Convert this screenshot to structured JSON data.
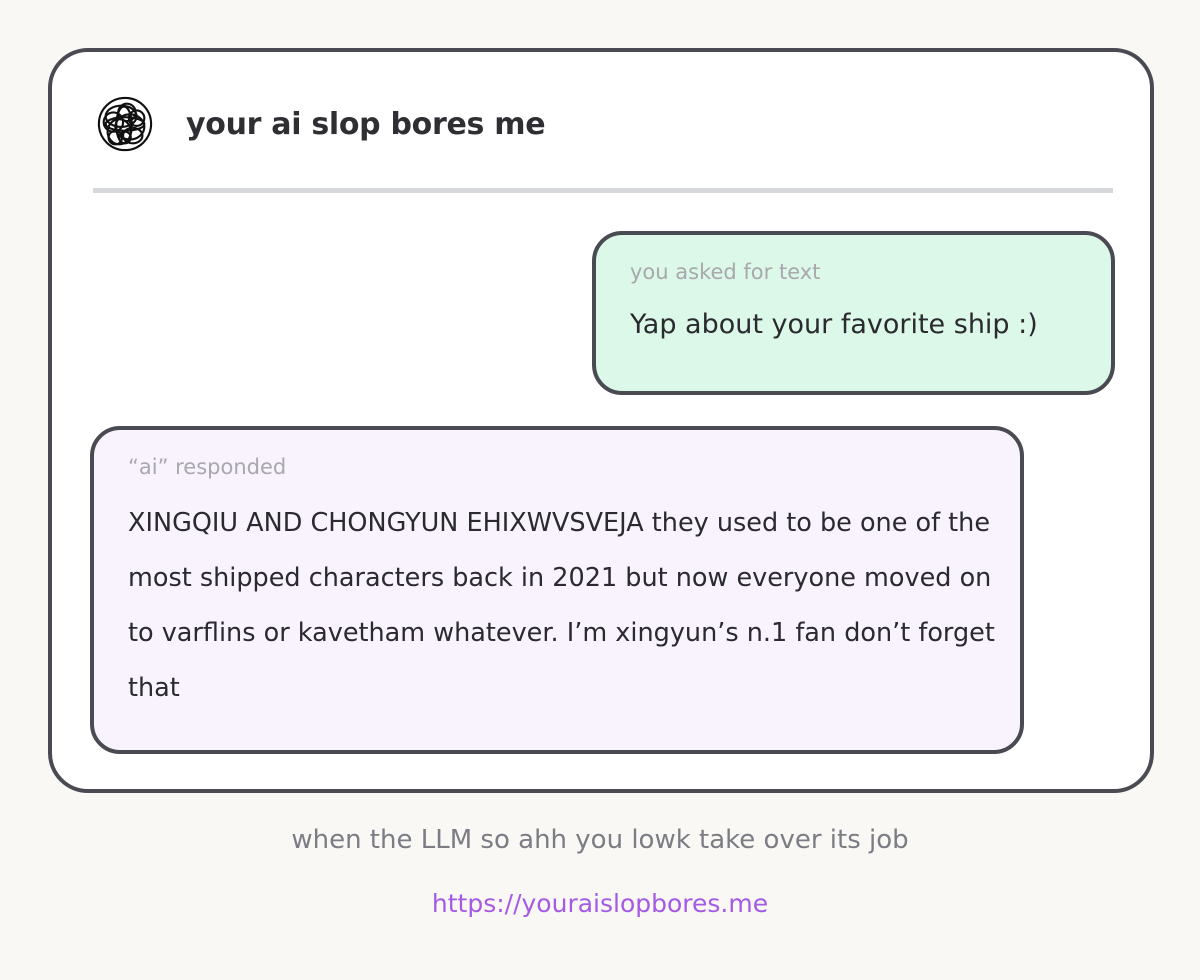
{
  "header": {
    "logo_icon": "scribble-ball-icon",
    "title": "your ai slop bores me"
  },
  "conversation": {
    "user_bubble": {
      "label": "you asked for text",
      "text": "Yap about your favorite ship :)",
      "background": "#dbf8e8"
    },
    "ai_bubble": {
      "label": "“ai” responded",
      "text": "XINGQIU AND CHONGYUN EHIXWVSVEJA they used to be one of the most shipped characters back in 2021 but now everyone moved on to varflins or kavetham whatever. I’m xingyun’s n.1 fan don’t forget that",
      "background": "#f8f3fd"
    }
  },
  "footer": {
    "caption": "when the LLM so ahh you lowk take over its job",
    "link": "https://youraislopbores.me",
    "link_color": "#a45ae6"
  },
  "colors": {
    "page_background": "#f9f8f4",
    "card_background": "#ffffff",
    "border": "#4a4a52",
    "divider": "#d6d7db"
  }
}
